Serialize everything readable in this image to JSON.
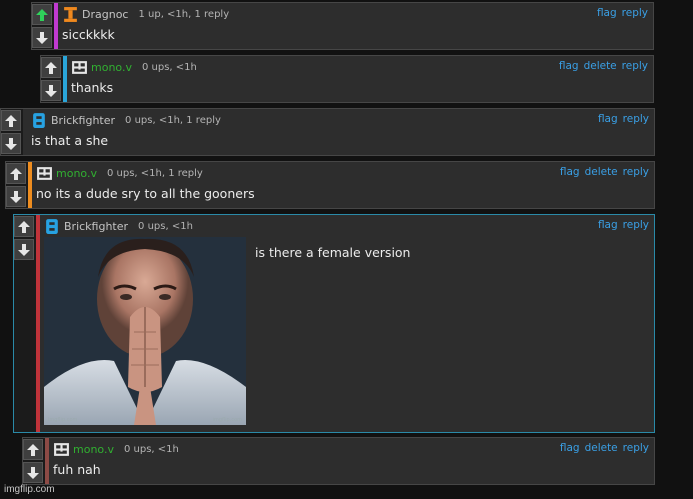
{
  "colors": {
    "background": "#111111",
    "panel": "#2d2d2d",
    "link": "#3aa0e6",
    "upvote_active": "#2fd25a",
    "selected_border": "#2a8aa8"
  },
  "icons": {
    "upvote": "up-arrow-icon",
    "downvote": "down-arrow-icon"
  },
  "comments": [
    {
      "username": "Dragnoc",
      "username_color": "#c5c5c5",
      "avatar_color": "#f0891e",
      "stripe_color": "#c03ad0",
      "meta": "1 up, <1h, 1 reply",
      "text": "sicckkkk",
      "actions": [
        "flag",
        "reply"
      ],
      "upvoted": true
    },
    {
      "username": "mono.v",
      "username_color": "#31b031",
      "avatar_color": "#e6e6e6",
      "stripe_color": "#2aa6da",
      "meta": "0 ups, <1h",
      "text": "thanks",
      "actions": [
        "flag",
        "delete",
        "reply"
      ],
      "upvoted": false
    },
    {
      "username": "Brickfighter",
      "username_color": "#c5c5c5",
      "avatar_color": "#27a2e2",
      "stripe_color": "#2d2d2d",
      "meta": "0 ups, <1h, 1 reply",
      "text": "is that a she",
      "actions": [
        "flag",
        "reply"
      ],
      "upvoted": false
    },
    {
      "username": "mono.v",
      "username_color": "#31b031",
      "avatar_color": "#e6e6e6",
      "stripe_color": "#ee8d20",
      "meta": "0 ups, <1h, 1 reply",
      "text": "no its a dude sry to all the gooners",
      "actions": [
        "flag",
        "delete",
        "reply"
      ],
      "upvoted": false
    },
    {
      "username": "Brickfighter",
      "username_color": "#c5c5c5",
      "avatar_color": "#27a2e2",
      "stripe_color": "#c0333a",
      "meta": "0 ups, <1h",
      "text": "is there a female version",
      "image_watermark": "imgflip.com",
      "actions": [
        "flag",
        "reply"
      ],
      "upvoted": false
    },
    {
      "username": "mono.v",
      "username_color": "#31b031",
      "avatar_color": "#e6e6e6",
      "stripe_color": "#8c4a45",
      "meta": "0 ups, <1h",
      "text": "fuh nah",
      "actions": [
        "flag",
        "delete",
        "reply"
      ],
      "upvoted": false
    }
  ],
  "footer_watermark": "imgflip.com"
}
